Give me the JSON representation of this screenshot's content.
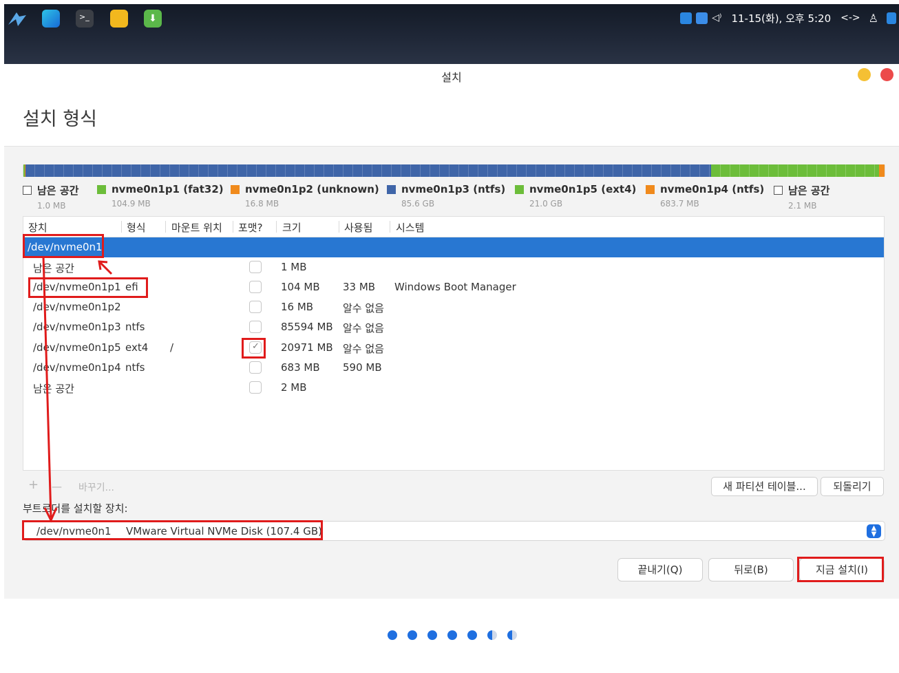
{
  "taskbar": {
    "clock": "11-15(화), 오후 5:20",
    "apps": [
      "start-icon",
      "browser-icon",
      "terminal-icon",
      "files-icon",
      "installer-icon"
    ]
  },
  "window": {
    "title": "설치",
    "page_title": "설치 형식"
  },
  "partition_bar": {
    "segments": [
      {
        "name": "남은 공간",
        "color": "#ffffff"
      },
      {
        "name": "nvme0n1p1 (fat32)",
        "color": "#6cbd3a"
      },
      {
        "name": "nvme0n1p2 (unknown)",
        "color": "#f08a1c"
      },
      {
        "name": "nvme0n1p3 (ntfs)",
        "color": "#3f65a8"
      },
      {
        "name": "nvme0n1p5 (ext4)",
        "color": "#6cbd3a"
      },
      {
        "name": "nvme0n1p4 (ntfs)",
        "color": "#f08a1c"
      },
      {
        "name": "남은 공간",
        "color": "#ffffff"
      }
    ]
  },
  "legend": [
    {
      "name": "남은 공간",
      "size": "1.0 MB",
      "color": "#ffffff"
    },
    {
      "name": "nvme0n1p1 (fat32)",
      "size": "104.9 MB",
      "color": "#6cbd3a"
    },
    {
      "name": "nvme0n1p2 (unknown)",
      "size": "16.8 MB",
      "color": "#f08a1c"
    },
    {
      "name": "nvme0n1p3 (ntfs)",
      "size": "85.6 GB",
      "color": "#3f65a8"
    },
    {
      "name": "nvme0n1p5 (ext4)",
      "size": "21.0 GB",
      "color": "#6cbd3a"
    },
    {
      "name": "nvme0n1p4 (ntfs)",
      "size": "683.7 MB",
      "color": "#f08a1c"
    },
    {
      "name": "남은 공간",
      "size": "2.1 MB",
      "color": "#ffffff"
    }
  ],
  "table": {
    "columns": [
      "장치",
      "형식",
      "마운트 위치",
      "포맷?",
      "크기",
      "사용됨",
      "시스템"
    ],
    "rows": [
      {
        "device": "/dev/nvme0n1",
        "type": "",
        "mount": "",
        "format": null,
        "size": "",
        "used": "",
        "system": "",
        "selected": true
      },
      {
        "device": "남은 공간",
        "type": "",
        "mount": "",
        "format": false,
        "size": "1 MB",
        "used": "",
        "system": ""
      },
      {
        "device": "/dev/nvme0n1p1",
        "type": "efi",
        "mount": "",
        "format": false,
        "size": "104 MB",
        "used": "33 MB",
        "system": "Windows Boot Manager"
      },
      {
        "device": "/dev/nvme0n1p2",
        "type": "",
        "mount": "",
        "format": false,
        "size": "16 MB",
        "used": "알수 없음",
        "system": ""
      },
      {
        "device": "/dev/nvme0n1p3",
        "type": "ntfs",
        "mount": "",
        "format": false,
        "size": "85594 MB",
        "used": "알수 없음",
        "system": ""
      },
      {
        "device": "/dev/nvme0n1p5",
        "type": "ext4",
        "mount": "/",
        "format": true,
        "size": "20971 MB",
        "used": "알수 없음",
        "system": ""
      },
      {
        "device": "/dev/nvme0n1p4",
        "type": "ntfs",
        "mount": "",
        "format": false,
        "size": "683 MB",
        "used": "590 MB",
        "system": ""
      },
      {
        "device": "남은 공간",
        "type": "",
        "mount": "",
        "format": false,
        "size": "2 MB",
        "used": "",
        "system": ""
      }
    ]
  },
  "toolbar": {
    "add": "+",
    "remove": "—",
    "change": "바꾸기...",
    "new_table": "새 파티션 테이블...",
    "revert": "되돌리기"
  },
  "bootloader": {
    "label": "부트로더를 설치할 장치:",
    "device": "/dev/nvme0n1",
    "description": "VMware Virtual NVMe Disk (107.4 GB)"
  },
  "actions": {
    "quit": "끝내기(Q)",
    "back": "뒤로(B)",
    "install": "지금 설치(I)"
  },
  "progress": {
    "completed_steps": 5,
    "half_steps": 2
  }
}
